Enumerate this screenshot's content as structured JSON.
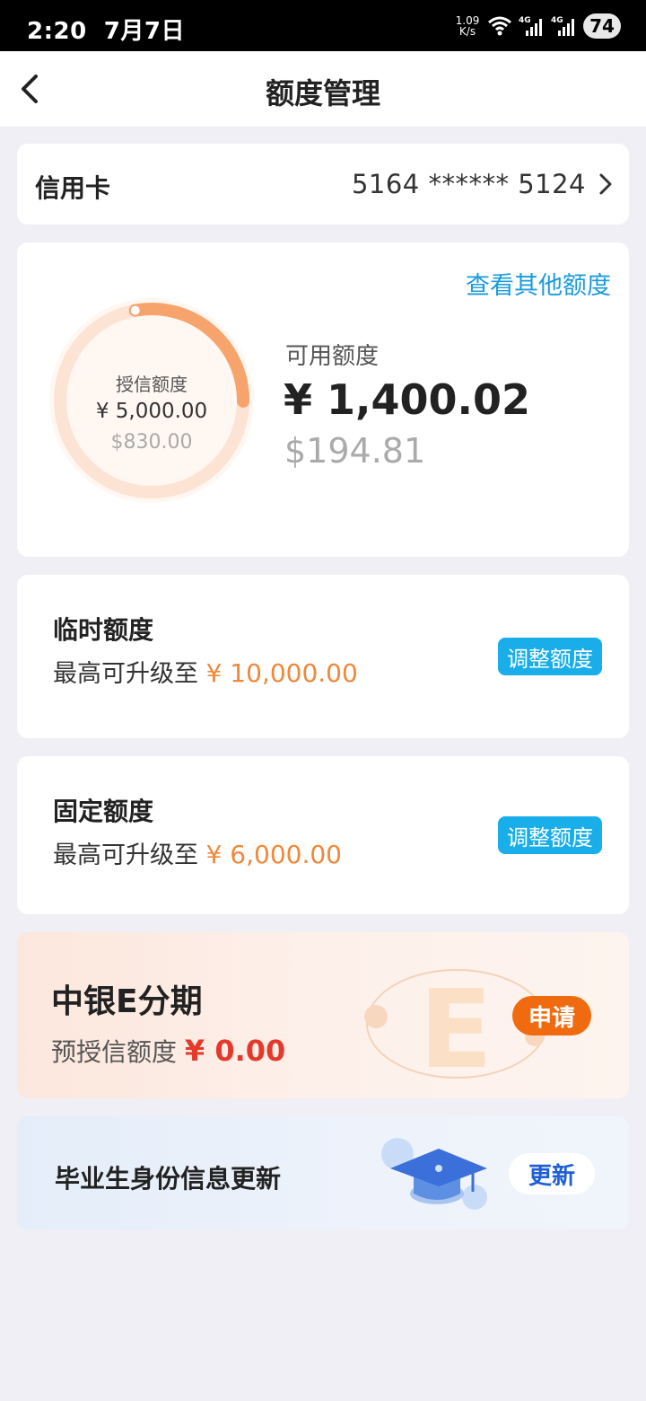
{
  "status_bar": {
    "time": "2:20",
    "date": "7月7日",
    "net_speed_value": "1.09",
    "net_speed_unit": "K/s",
    "battery": "74",
    "icons": [
      "wifi-icon",
      "signal-4g-icon",
      "signal-4g-icon"
    ]
  },
  "nav": {
    "title": "额度管理",
    "back_icon": "chevron-left-icon"
  },
  "card_selector": {
    "label": "信用卡",
    "card_number": "5164 ****** 5124",
    "chevron_icon": "chevron-right-icon"
  },
  "overview": {
    "other_limits_link": "查看其他额度",
    "credit_limit_label": "授信额度",
    "credit_limit_cny": "¥ 5,000.00",
    "credit_limit_usd": "$830.00",
    "available_label": "可用额度",
    "available_cny": "¥ 1,400.02",
    "available_usd": "$194.81",
    "ring_used_fraction": 0.28,
    "ring_color": "#f7a36c",
    "ring_track_color": "#fde3d3"
  },
  "temporary_limit": {
    "title": "临时额度",
    "desc_prefix": "最高可升级至",
    "amount": "¥ 10,000.00",
    "button": "调整额度"
  },
  "fixed_limit": {
    "title": "固定额度",
    "desc_prefix": "最高可升级至",
    "amount": "¥ 6,000.00",
    "button": "调整额度"
  },
  "installment": {
    "title": "中银E分期",
    "desc_prefix": "预授信额度",
    "amount": "¥ 0.00",
    "button": "申请"
  },
  "graduate": {
    "title": "毕业生身份信息更新",
    "button": "更新",
    "icon": "graduation-cap-icon"
  },
  "colors": {
    "accent_blue": "#19aee9",
    "amount_orange": "#f0883a",
    "apply_orange": "#f06b10",
    "amount_red": "#e33a2c",
    "update_blue": "#1e5fd6"
  }
}
